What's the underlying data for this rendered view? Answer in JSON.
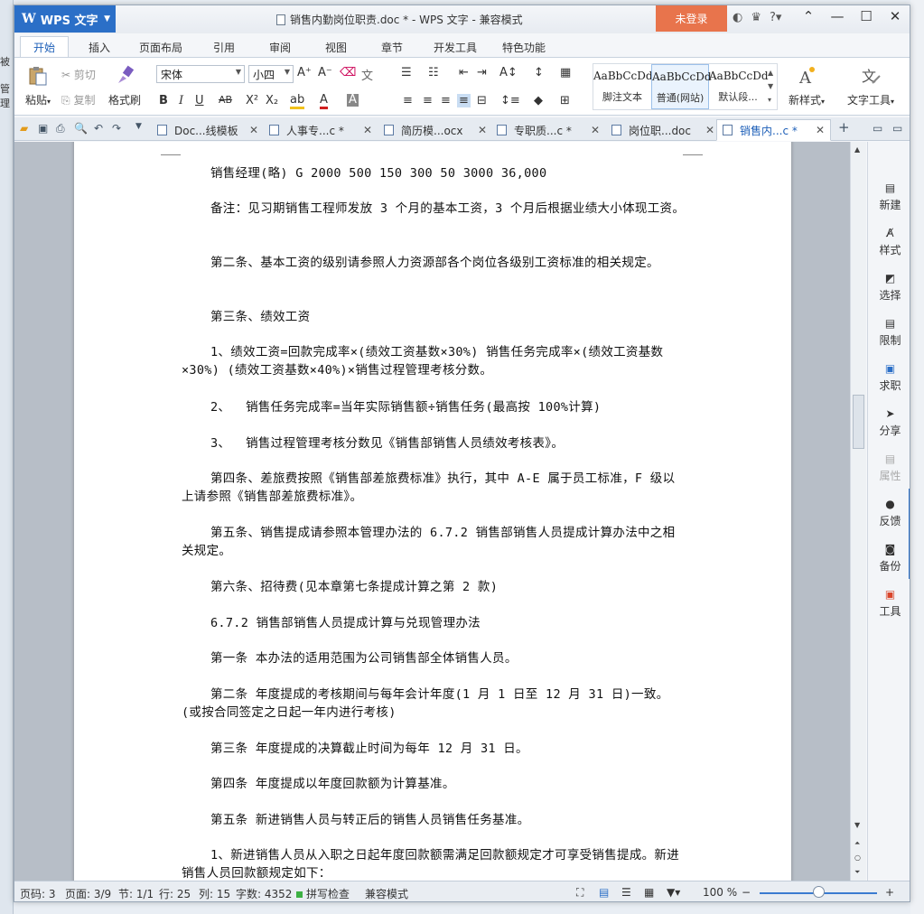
{
  "background": {
    "left_fragments": [
      "被",
      "管理"
    ]
  },
  "titlebar": {
    "app_name": "WPS 文字",
    "logo": "W",
    "title": "销售内勤岗位职责.doc * - WPS 文字 - 兼容模式",
    "login_label": "未登录",
    "help_label": "?"
  },
  "menu": {
    "tabs": [
      "开始",
      "插入",
      "页面布局",
      "引用",
      "审阅",
      "视图",
      "章节",
      "开发工具",
      "特色功能"
    ],
    "active_tab": "开始"
  },
  "ribbon": {
    "paste": "粘贴",
    "cut": "剪切",
    "copy": "复制",
    "format_painter": "格式刷",
    "font_name": "宋体",
    "font_size": "小四",
    "bold": "B",
    "italic": "I",
    "underline": "U",
    "strike": "AB",
    "superscript": "X²",
    "subscript": "X₂",
    "grow_font": "A⁺",
    "shrink_font": "A⁻",
    "styles": [
      {
        "sample": "AaBbCcDd",
        "name": "脚注文本"
      },
      {
        "sample": "AaBbCcDd",
        "name": "普通(网站)"
      },
      {
        "sample": "AaBbCcDd",
        "name": "默认段..."
      }
    ],
    "new_style": "新样式",
    "text_tools": "文字工具"
  },
  "doctabs": [
    {
      "label": "Doc...线模板",
      "active": false
    },
    {
      "label": "人事专...c *",
      "active": false
    },
    {
      "label": "简历模...ocx",
      "active": false
    },
    {
      "label": "专职质...c *",
      "active": false
    },
    {
      "label": "岗位职...doc",
      "active": false
    },
    {
      "label": "销售内...c *",
      "active": true
    }
  ],
  "document": {
    "paragraphs": [
      "销售经理(略) G 2000 500 150 300 50 3000 36,000",
      "备注：见习期销售工程师发放 3 个月的基本工资，3 个月后根据业绩大小体现工资。",
      "第二条、基本工资的级别请参照人力资源部各个岗位各级别工资标准的相关规定。",
      "第三条、绩效工资",
      "1、绩效工资=回款完成率×(绩效工资基数×30%) 销售任务完成率×(绩效工资基数×30%) (绩效工资基数×40%)×销售过程管理考核分数。",
      "2、  销售任务完成率=当年实际销售额÷销售任务(最高按 100%计算)",
      "3、  销售过程管理考核分数见《销售部销售人员绩效考核表》。",
      "第四条、差旅费按照《销售部差旅费标准》执行，其中 A-E 属于员工标准，F 级以上请参照《销售部差旅费标准》。",
      "第五条、销售提成请参照本管理办法的 6.7.2 销售部销售人员提成计算办法中之相关规定。",
      "第六条、招待费(见本章第七条提成计算之第 2 款)",
      "6.7.2 销售部销售人员提成计算与兑现管理办法",
      "第一条 本办法的适用范围为公司销售部全体销售人员。",
      "第二条 年度提成的考核期间与每年会计年度(1 月 1 日至 12 月 31 日)一致。(或按合同签定之日起一年内进行考核)",
      "第三条 年度提成的决算截止时间为每年 12 月 31 日。",
      "第四条 年度提成以年度回款额为计算基准。",
      "第五条 新进销售人员与转正后的销售人员销售任务基准。",
      "1、新进销售人员从入职之日起年度回款额需满足回款额规定才可享受销售提成。新进销售人员回款额规定如下："
    ]
  },
  "taskpane": {
    "items": [
      {
        "label": "新建",
        "dim": false
      },
      {
        "label": "样式",
        "dim": false
      },
      {
        "label": "选择",
        "dim": false
      },
      {
        "label": "限制",
        "dim": false
      },
      {
        "label": "求职",
        "dim": false
      },
      {
        "label": "分享",
        "dim": false
      },
      {
        "label": "属性",
        "dim": true
      },
      {
        "label": "反馈",
        "dim": false
      },
      {
        "label": "备份",
        "dim": false
      },
      {
        "label": "工具",
        "dim": false
      }
    ]
  },
  "status": {
    "page_num": "页码: 3",
    "pages": "页面: 3/9",
    "section": "节: 1/1",
    "row": "行: 25",
    "col": "列: 15",
    "word_count": "字数: 4352",
    "spell_check": "拼写检查",
    "compat_mode": "兼容模式",
    "zoom": "100 %"
  }
}
